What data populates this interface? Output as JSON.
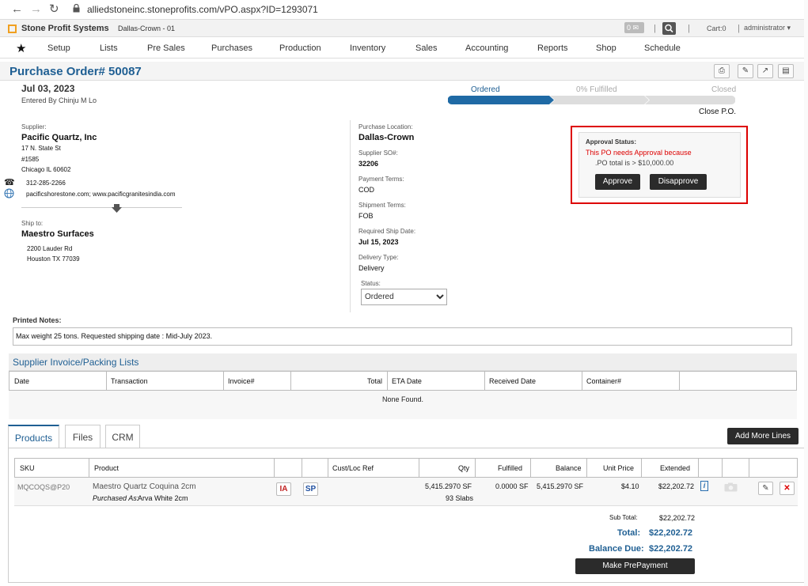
{
  "browser": {
    "url": "alliedstoneinc.stoneprofits.com/vPO.aspx?ID=1293071"
  },
  "header": {
    "brand": "Stone Profit Systems",
    "location": "Dallas-Crown - 01",
    "mail_count": "0",
    "cart": "Cart:0",
    "user": "administrator"
  },
  "menu": [
    "Setup",
    "Lists",
    "Pre Sales",
    "Purchases",
    "Production",
    "Inventory",
    "Sales",
    "Accounting",
    "Reports",
    "Shop",
    "Schedule"
  ],
  "po": {
    "title": "Purchase Order# 50087",
    "date": "Jul 03, 2023",
    "entered_by": "Entered By Chinju M Lo"
  },
  "progress": {
    "steps": [
      "Ordered",
      "0% Fulfilled",
      "Closed"
    ],
    "close_label": "Close P.O."
  },
  "supplier": {
    "label": "Supplier:",
    "name": "Pacific Quartz, Inc",
    "addr1": "17 N. State St",
    "addr2": "#1585",
    "addr3": "Chicago IL 60602",
    "phone": "312-285-2266",
    "web": "pacificshorestone.com; www.pacificgranitesindia.com"
  },
  "ship_to": {
    "label": "Ship to:",
    "name": "Maestro Surfaces",
    "addr1": "2200 Lauder Rd",
    "addr2": "Houston TX 77039"
  },
  "details": {
    "purchase_location_label": "Purchase Location:",
    "purchase_location": "Dallas-Crown",
    "supplier_so_label": "Supplier SO#:",
    "supplier_so": "32206",
    "payment_terms_label": "Payment Terms:",
    "payment_terms": "COD",
    "shipment_terms_label": "Shipment Terms:",
    "shipment_terms": "FOB",
    "req_ship_label": "Required Ship Date:",
    "req_ship": "Jul 15, 2023",
    "delivery_type_label": "Delivery Type:",
    "delivery_type": "Delivery",
    "status_label": "Status:",
    "status": "Ordered"
  },
  "approval": {
    "label": "Approval Status:",
    "warning": "This PO needs Approval because",
    "reason": ".PO total is > $10,000.00",
    "approve": "Approve",
    "disapprove": "Disapprove"
  },
  "notes": {
    "label": "Printed Notes:",
    "text": "Max weight 25 tons. Requested shipping date : Mid-July 2023."
  },
  "invoices": {
    "title": "Supplier Invoice/Packing Lists",
    "columns": [
      "Date",
      "Transaction",
      "Invoice#",
      "Total",
      "ETA Date",
      "Received Date",
      "Container#"
    ],
    "empty": "None Found."
  },
  "tabs": [
    "Products",
    "Files",
    "CRM"
  ],
  "add_lines": "Add More Lines",
  "products": {
    "columns": [
      "SKU",
      "Product",
      "Cust/Loc Ref",
      "Qty",
      "Fulfilled",
      "Balance",
      "Unit Price",
      "Extended"
    ],
    "rows": [
      {
        "sku": "MQCOQS@P20",
        "product": "Maestro Quartz Coquina 2cm",
        "purchased_as_label": "Purchased As:",
        "purchased_as": "Arva White 2cm",
        "chip1": "IA",
        "chip2": "SP",
        "qty": "5,415.2970 SF",
        "qty_slabs": "93 Slabs",
        "fulfilled": "0.0000 SF",
        "balance": "5,415.2970 SF",
        "unit_price": "$4.10",
        "extended": "$22,202.72"
      }
    ]
  },
  "totals": {
    "subtotal_label": "Sub Total:",
    "subtotal": "$22,202.72",
    "total_label": "Total:",
    "total": "$22,202.72",
    "balance_label": "Balance Due:",
    "balance": "$22,202.72",
    "prepay": "Make PrePayment"
  },
  "colors": {
    "accent": "#1f5f93",
    "alert": "#d00000",
    "dark_button": "#2b2b2b"
  }
}
